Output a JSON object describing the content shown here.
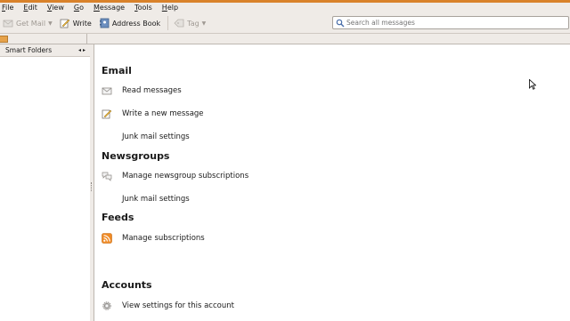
{
  "menubar": {
    "items": [
      {
        "key": "F",
        "rest": "ile"
      },
      {
        "key": "E",
        "rest": "dit"
      },
      {
        "key": "V",
        "rest": "iew"
      },
      {
        "key": "G",
        "rest": "o"
      },
      {
        "key": "M",
        "rest": "essage"
      },
      {
        "key": "T",
        "rest": "ools"
      },
      {
        "key": "H",
        "rest": "elp"
      }
    ]
  },
  "toolbar": {
    "get_mail": "Get Mail",
    "write": "Write",
    "address_book": "Address Book",
    "tag": "Tag"
  },
  "search": {
    "placeholder": "Search all messages"
  },
  "sidebar": {
    "header": "Smart Folders"
  },
  "content": {
    "email": {
      "title": "Email",
      "read": "Read messages",
      "write": "Write a new message",
      "junk": "Junk mail settings"
    },
    "newsgroups": {
      "title": "Newsgroups",
      "manage": "Manage newsgroup subscriptions",
      "junk": "Junk mail settings"
    },
    "feeds": {
      "title": "Feeds",
      "manage": "Manage subscriptions"
    },
    "accounts": {
      "title": "Accounts",
      "view": "View settings for this account"
    }
  },
  "colors": {
    "accent_orange": "#d9822b",
    "background": "#efebe7",
    "rss": "#f08a24"
  },
  "icons": [
    "get-mail-icon",
    "write-icon",
    "address-book-icon",
    "tag-icon",
    "search-icon",
    "read-messages-icon",
    "write-message-icon",
    "newsgroup-icon",
    "rss-feed-icon",
    "gear-icon",
    "mouse-cursor"
  ]
}
